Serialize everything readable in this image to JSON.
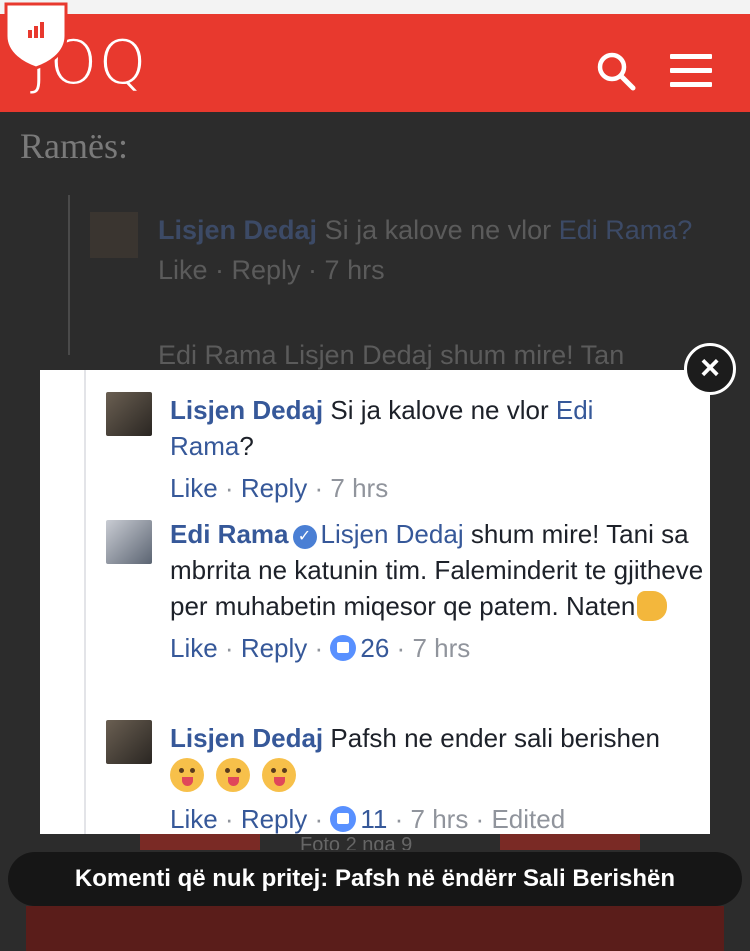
{
  "header": {
    "logo_text": "JOQ"
  },
  "background": {
    "heading": "Ramës:",
    "comment_name": "Lisjen Dedaj",
    "comment_text": "Si ja kalove ne vlor",
    "comment_link": "Edi Rama?",
    "comment_meta": "Like · Reply · 7 hrs",
    "partial_text": "Edi Rama  Lisjen Dedaj shum mire! Tan"
  },
  "modal": {
    "comments": [
      {
        "name": "Lisjen Dedaj",
        "text": "Si ja kalove ne vlor",
        "link": "Edi",
        "link2": "Rama",
        "suffix": "?",
        "like": "Like",
        "reply": "Reply",
        "time": "7 hrs"
      },
      {
        "name": "Edi Rama",
        "mention": "Lisjen Dedaj",
        "text": "shum mire! Tani sa mbrrita ne katunin tim. Faleminderit te gjitheve per muhabetin miqesor qe patem. Naten",
        "like": "Like",
        "reply": "Reply",
        "likes_count": "26",
        "time": "7 hrs"
      },
      {
        "name": "Lisjen Dedaj",
        "text": "Pafsh ne ender sali berishen",
        "like": "Like",
        "reply": "Reply",
        "likes_count": "11",
        "time": "7 hrs",
        "edited": "Edited"
      }
    ]
  },
  "bottom": {
    "dim_text": "Foto 2 nga 9",
    "caption": "Komenti që nuk pritej: Pafsh në ëndërr Sali Berishën"
  },
  "colors": {
    "header": "#e8392e",
    "link": "#365899",
    "meta": "#90949c"
  }
}
